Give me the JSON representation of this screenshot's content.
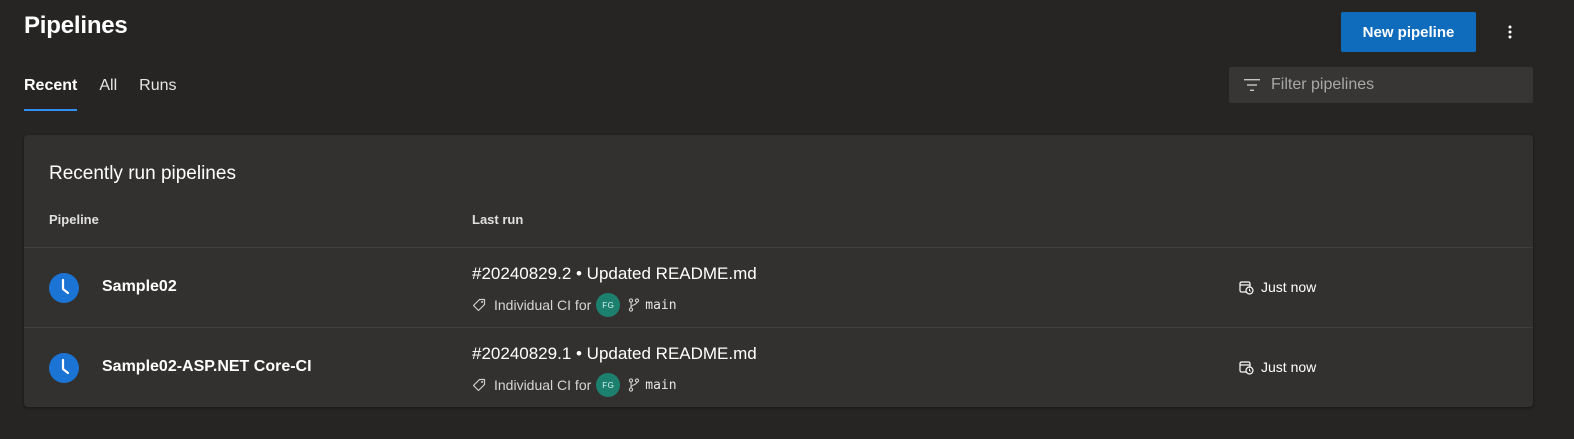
{
  "header": {
    "title": "Pipelines",
    "new_button_label": "New pipeline",
    "more_icon": "more-vertical-icon"
  },
  "tabs": [
    {
      "label": "Recent",
      "active": true
    },
    {
      "label": "All",
      "active": false
    },
    {
      "label": "Runs",
      "active": false
    }
  ],
  "filter": {
    "placeholder": "Filter pipelines",
    "value": "",
    "icon": "filter-icon"
  },
  "card": {
    "title": "Recently run pipelines",
    "columns": {
      "pipeline": "Pipeline",
      "last_run": "Last run"
    },
    "rows": [
      {
        "status_icon": "in-progress-clock-icon",
        "name": "Sample02",
        "run_title": "#20240829.2 • Updated README.md",
        "trigger": "Individual CI for",
        "avatar_initials": "FG",
        "branch": "main",
        "time": "Just now"
      },
      {
        "status_icon": "in-progress-clock-icon",
        "name": "Sample02-ASP.NET Core-CI",
        "run_title": "#20240829.1 • Updated README.md",
        "trigger": "Individual CI for",
        "avatar_initials": "FG",
        "branch": "main",
        "time": "Just now"
      }
    ]
  },
  "colors": {
    "background": "#262524",
    "card": "#32312f",
    "accent": "#0f6cbd",
    "status_blue": "#1b74d4",
    "avatar": "#1d7f6e"
  }
}
